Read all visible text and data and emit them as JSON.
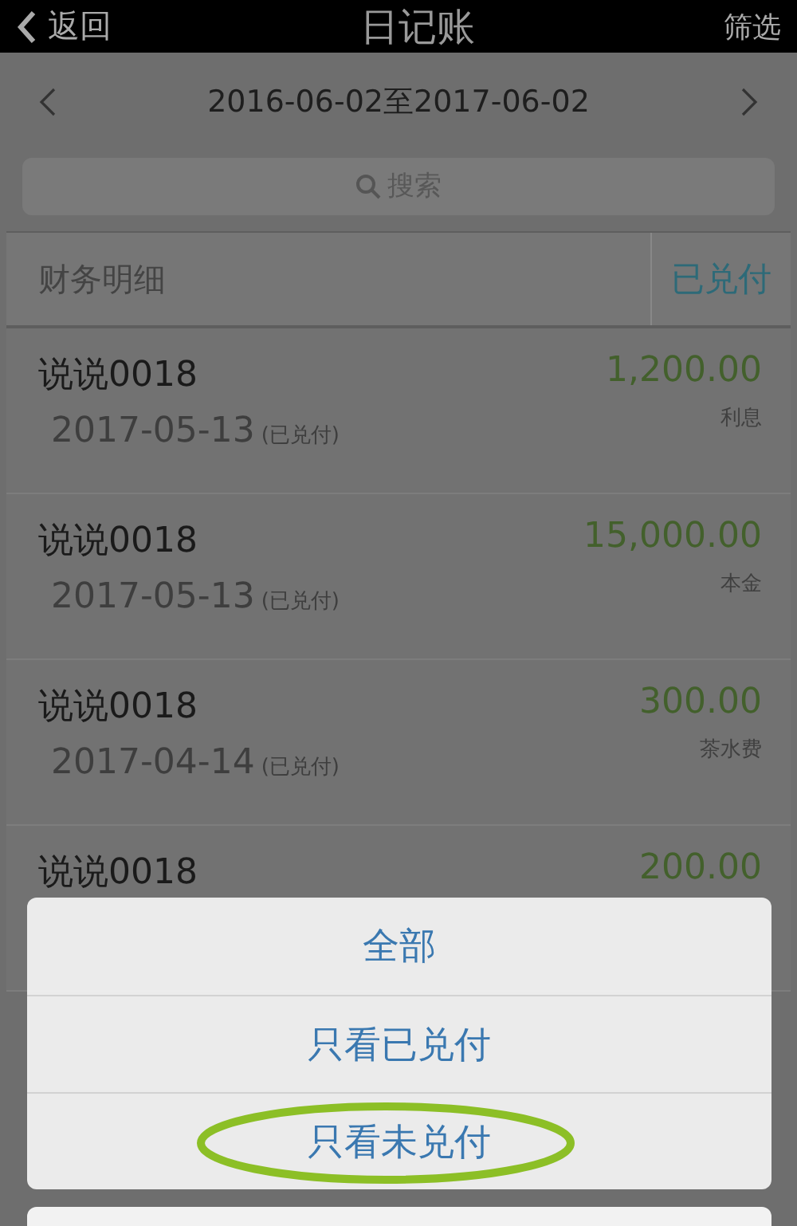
{
  "nav": {
    "back": "返回",
    "title": "日记账",
    "filter": "筛选"
  },
  "date_range": "2016-06-02至2017-06-02",
  "search": {
    "placeholder": "搜索"
  },
  "list_header": {
    "title": "财务明细",
    "status": "已兑付"
  },
  "entries": [
    {
      "name": "说说0018",
      "date": "2017-05-13",
      "status": "(已兑付)",
      "amount": "1,200.00",
      "category": "利息"
    },
    {
      "name": "说说0018",
      "date": "2017-05-13",
      "status": "(已兑付)",
      "amount": "15,000.00",
      "category": "本金"
    },
    {
      "name": "说说0018",
      "date": "2017-04-14",
      "status": "(已兑付)",
      "amount": "300.00",
      "category": "茶水费"
    },
    {
      "name": "说说0018",
      "amount": "200.00"
    }
  ],
  "action_sheet": {
    "options": [
      {
        "label": "全部",
        "highlighted": false
      },
      {
        "label": "只看已兑付",
        "highlighted": false
      },
      {
        "label": "只看未兑付",
        "highlighted": true
      }
    ]
  }
}
